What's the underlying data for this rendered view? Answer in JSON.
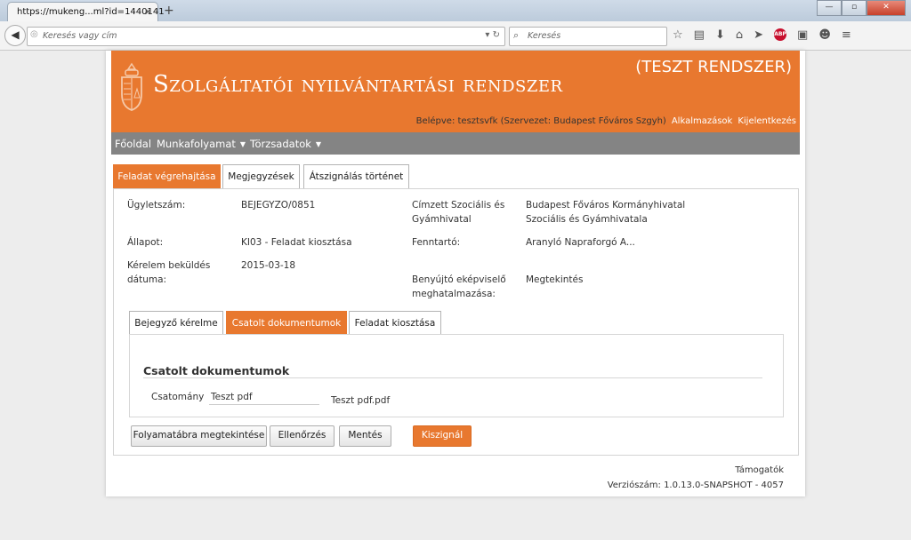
{
  "browser": {
    "tab_title": "https://mukeng...ml?id=1440141",
    "tab_close": "✕",
    "new_tab": "+",
    "url_placeholder": "Keresés vagy cím",
    "search_placeholder": "Keresés",
    "abp_label": "ABP",
    "win_min": "—",
    "win_max": "▫",
    "win_close": "✕"
  },
  "header": {
    "title": "Szolgáltatói nyilvántartási rendszer",
    "test_label": "(TESZT RENDSZER)",
    "login_text": "Belépve: tesztsvfk (Szervezet: Budapest Főváros Szgyh)",
    "apps_link": "Alkalmazások",
    "logout_link": "Kijelentkezés"
  },
  "menu": {
    "home": "Főoldal",
    "workflow": "Munkafolyamat",
    "master_data": "Törzsadatok"
  },
  "tabs": [
    "Feladat végrehajtása",
    "Megjegyzések",
    "Átszignálás történet"
  ],
  "details": {
    "case_number_label": "Ügyletszám:",
    "case_number": "BEJEGYZO/0851",
    "status_label": "Állapot:",
    "status": "KI03 - Feladat kiosztása",
    "submit_date_label_1": "Kérelem beküldés",
    "submit_date_label_2": "dátuma:",
    "submit_date": "2015-03-18",
    "recipient_label_1": "Címzett Szociális és",
    "recipient_label_2": "Gyámhivatal",
    "recipient_1": "Budapest Főváros Kormányhivatal",
    "recipient_2": "Szociális és Gyámhivatala",
    "maintainer_label": "Fenntartó:",
    "maintainer": "Aranyló Napraforgó A...",
    "authorization_label_1": "Benyújtó eképviselő",
    "authorization_label_2": "meghatalmazása:",
    "authorization_link": "Megtekintés"
  },
  "subtabs": [
    "Bejegyző kérelme",
    "Csatolt dokumentumok",
    "Feladat kiosztása"
  ],
  "attachments": {
    "heading": "Csatolt dokumentumok",
    "label": "Csatomány",
    "value": "Teszt pdf",
    "file": "Teszt pdf.pdf"
  },
  "buttons": {
    "flowchart": "Folyamatábra megtekintése",
    "check": "Ellenőrzés",
    "save": "Mentés",
    "assign": "Kiszignál"
  },
  "footer": {
    "support": "Támogatók",
    "version": "Verziószám: 1.0.13.0-SNAPSHOT - 4057"
  }
}
